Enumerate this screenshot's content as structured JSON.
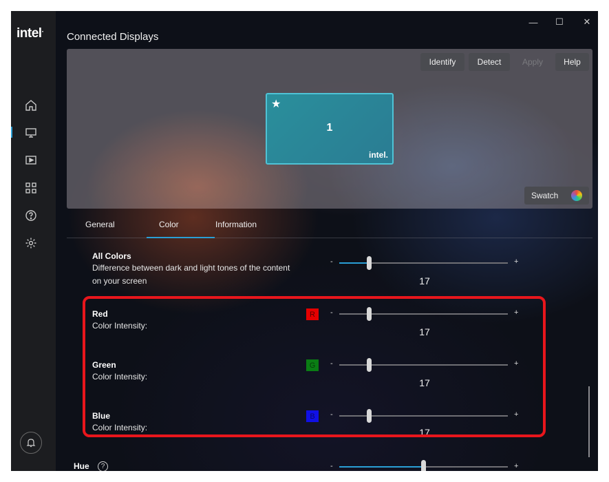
{
  "app": {
    "logo_text": "intel"
  },
  "window_controls": {
    "minimize": "—",
    "maximize": "☐",
    "close": "✕"
  },
  "sidebar": {
    "items": [
      {
        "name": "home-icon"
      },
      {
        "name": "display-icon",
        "active": true
      },
      {
        "name": "video-icon"
      },
      {
        "name": "apps-icon"
      },
      {
        "name": "help-icon"
      },
      {
        "name": "settings-icon"
      }
    ],
    "bell_icon": "bell-icon"
  },
  "page": {
    "title": "Connected Displays"
  },
  "toolbar": {
    "identify": "Identify",
    "detect": "Detect",
    "apply": "Apply",
    "help": "Help"
  },
  "monitor": {
    "star": "★",
    "number": "1",
    "logo": "intel."
  },
  "swatch": {
    "label": "Swatch",
    "icon": "color-wheel-icon"
  },
  "tabs": [
    {
      "label": "General",
      "active": false
    },
    {
      "label": "Color",
      "active": true
    },
    {
      "label": "Information",
      "active": false
    }
  ],
  "settings": {
    "all_colors": {
      "title": "All Colors",
      "desc_line1": "Difference between dark and light tones of the content",
      "desc_line2": "on your screen",
      "value": "17",
      "minus": "-",
      "plus": "+"
    },
    "red": {
      "title": "Red",
      "desc": "Color Intensity:",
      "chip": "R",
      "chip_color": "#e50000",
      "value": "17",
      "minus": "-",
      "plus": "+"
    },
    "green": {
      "title": "Green",
      "desc": "Color Intensity:",
      "chip": "G",
      "chip_color": "#0a7d14",
      "value": "17",
      "minus": "-",
      "plus": "+"
    },
    "blue": {
      "title": "Blue",
      "desc": "Color Intensity:",
      "chip": "B",
      "chip_color": "#1010e6",
      "value": "17",
      "minus": "-",
      "plus": "+"
    },
    "hue": {
      "title": "Hue",
      "help": "?",
      "minus": "-",
      "plus": "+"
    }
  },
  "colors": {
    "accent": "#2a9fd6",
    "highlight": "#e8161c"
  }
}
